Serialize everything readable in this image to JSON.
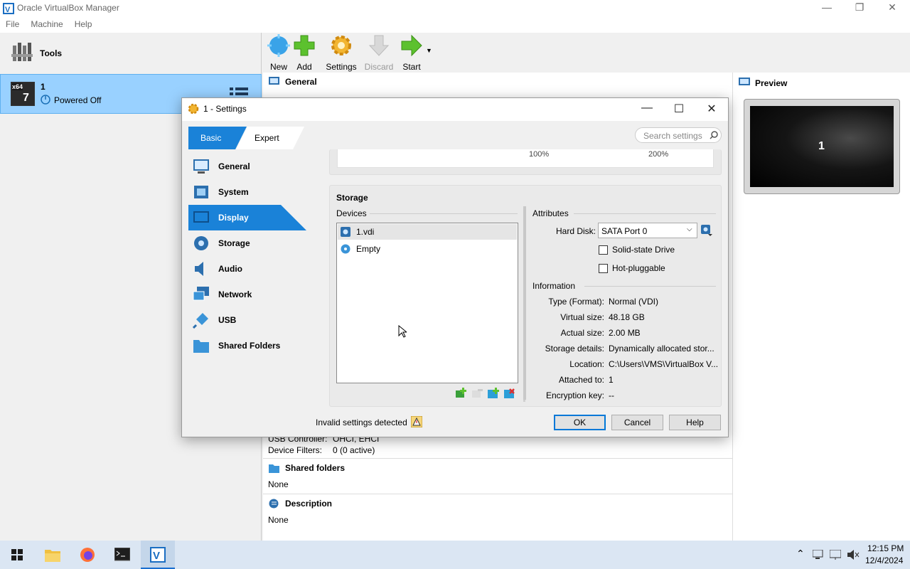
{
  "window": {
    "title": "Oracle VirtualBox Manager",
    "minimize": "—",
    "restore": "❐",
    "close": "✕"
  },
  "menu": [
    "File",
    "Machine",
    "Help"
  ],
  "left": {
    "tools_label": "Tools",
    "vm": {
      "name": "1",
      "state": "Powered Off",
      "os_badge": "x64"
    }
  },
  "toolbar": {
    "new": "New",
    "add": "Add",
    "settings": "Settings",
    "discard": "Discard",
    "start": "Start"
  },
  "details": {
    "general": "General",
    "usb_lines": [
      {
        "label": "USB Controller:",
        "value": "OHCI, EHCI"
      },
      {
        "label": "Device Filters:",
        "value": "0 (0 active)"
      }
    ],
    "shared_folders": "Shared folders",
    "shared_none": "None",
    "description": "Description",
    "description_none": "None"
  },
  "preview": {
    "title": "Preview",
    "screen_text": "1"
  },
  "dialog": {
    "title": "1 - Settings",
    "tabs": {
      "basic": "Basic",
      "expert": "Expert"
    },
    "search_placeholder": "Search settings",
    "sidebar": [
      "General",
      "System",
      "Display",
      "Storage",
      "Audio",
      "Network",
      "USB",
      "Shared Folders"
    ],
    "selected": "Display",
    "scale_ticks": [
      "100%",
      "200%"
    ],
    "storage": {
      "title": "Storage",
      "devices_label": "Devices",
      "devices": [
        "1.vdi",
        "Empty"
      ],
      "attributes_label": "Attributes",
      "hard_disk_label": "Hard Disk:",
      "hard_disk_value": "SATA Port 0",
      "ssd_label": "Solid-state Drive",
      "hotplug_label": "Hot-pluggable",
      "information_label": "Information",
      "info": [
        {
          "label": "Type (Format):",
          "value": "Normal (VDI)"
        },
        {
          "label": "Virtual size:",
          "value": "48.18 GB"
        },
        {
          "label": "Actual size:",
          "value": "2.00 MB"
        },
        {
          "label": "Storage details:",
          "value": "Dynamically allocated stor..."
        },
        {
          "label": "Location:",
          "value": "C:\\Users\\VMS\\VirtualBox V..."
        },
        {
          "label": "Attached to:",
          "value": "1"
        },
        {
          "label": "Encryption key:",
          "value": "--"
        }
      ]
    },
    "invalid_text": "Invalid settings detected",
    "buttons": {
      "ok": "OK",
      "cancel": "Cancel",
      "help": "Help"
    }
  },
  "taskbar": {
    "time": "12:15 PM",
    "date": "12/4/2024"
  },
  "colors": {
    "accent": "#1a82d8",
    "selection": "#99d1ff"
  }
}
